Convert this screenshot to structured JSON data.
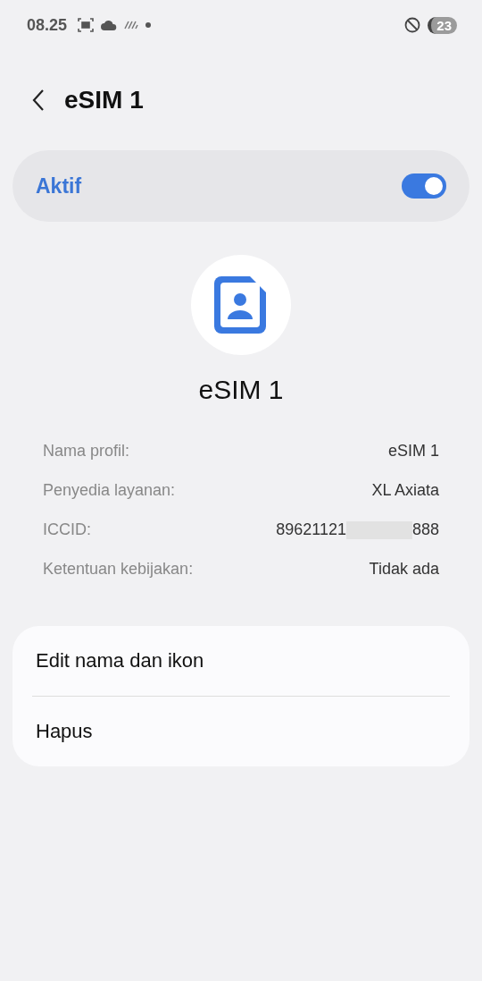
{
  "status_bar": {
    "time": "08.25",
    "battery": "23"
  },
  "header": {
    "title": "eSIM 1"
  },
  "active_toggle": {
    "label": "Aktif",
    "on": true
  },
  "profile": {
    "name": "eSIM 1"
  },
  "details": [
    {
      "label": "Nama profil:",
      "value": "eSIM 1"
    },
    {
      "label": "Penyedia layanan:",
      "value": "XL Axiata"
    },
    {
      "label": "ICCID:",
      "value": "89621121",
      "value_end": "888",
      "redacted": true
    },
    {
      "label": "Ketentuan kebijakan:",
      "value": "Tidak ada"
    }
  ],
  "actions": [
    {
      "label": "Edit nama dan ikon"
    },
    {
      "label": "Hapus"
    }
  ]
}
